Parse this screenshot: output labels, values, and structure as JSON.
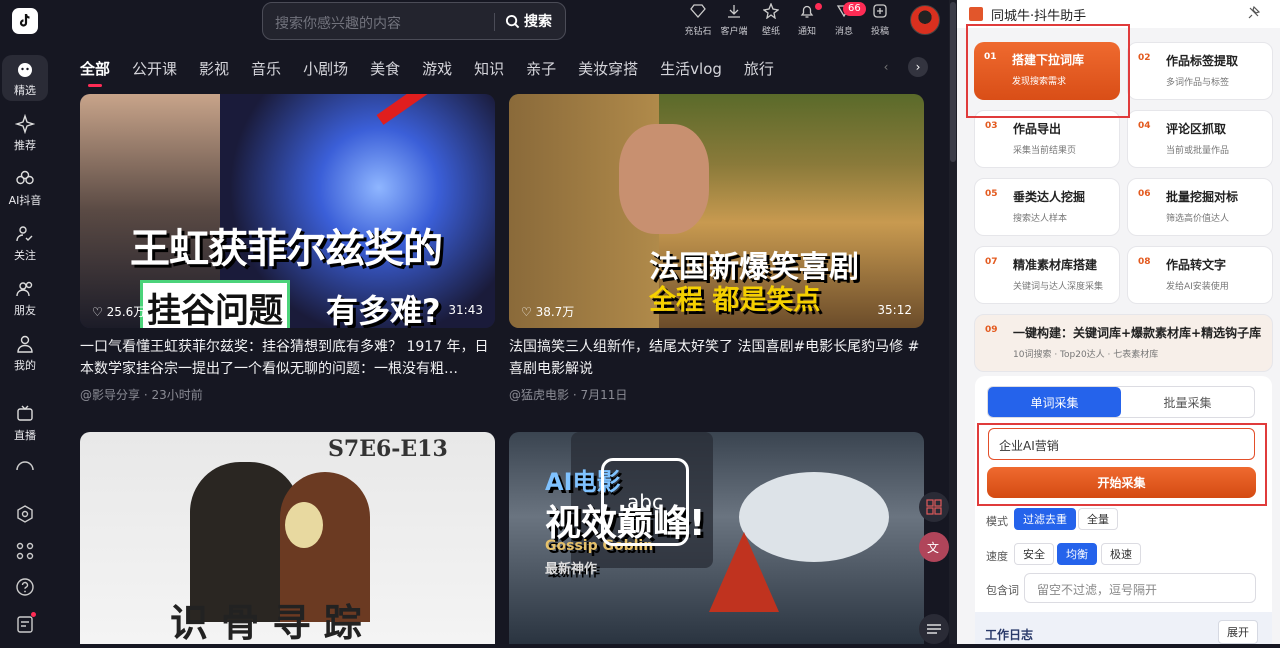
{
  "nav": {
    "items": [
      {
        "label": "精选",
        "icon": "home-icon"
      },
      {
        "label": "推荐",
        "icon": "sparkle-icon"
      },
      {
        "label": "AI抖音",
        "icon": "flower-icon"
      },
      {
        "label": "关注",
        "icon": "follow-icon"
      },
      {
        "label": "朋友",
        "icon": "friends-icon"
      },
      {
        "label": "我的",
        "icon": "person-icon"
      },
      {
        "label": "直播",
        "icon": "tv-icon"
      }
    ]
  },
  "search": {
    "placeholder": "搜索你感兴趣的内容",
    "button": "搜索"
  },
  "toolbar": [
    {
      "label": "充钻石",
      "icon": "diamond-icon"
    },
    {
      "label": "客户端",
      "icon": "download-icon"
    },
    {
      "label": "壁纸",
      "icon": "wallpaper-icon"
    },
    {
      "label": "通知",
      "icon": "bell-icon"
    },
    {
      "label": "消息",
      "icon": "message-icon",
      "badge": "66"
    },
    {
      "label": "投稿",
      "icon": "upload-icon"
    }
  ],
  "tabs": [
    "全部",
    "公开课",
    "影视",
    "音乐",
    "小剧场",
    "美食",
    "游戏",
    "知识",
    "亲子",
    "美妆穿搭",
    "生活vlog",
    "旅行"
  ],
  "videos": [
    {
      "likes": "25.6万",
      "duration": "31:43",
      "title": "一口气看懂王虹获菲尔兹奖：挂谷猜想到底有多难？ 1917 年，日本数学家挂谷宗一提出了一个看似无聊的问题：一根没有粗…",
      "author": "@影导分享",
      "time": "23小时前",
      "overlay1": "王虹获菲尔兹奖的",
      "overlay2": "挂谷问题",
      "overlay3": "有多难?"
    },
    {
      "likes": "38.7万",
      "duration": "35:12",
      "title": "法国搞笑三人组新作，结尾太好笑了 法国喜剧#电影长尾豹马修 #喜剧电影解说",
      "author": "@猛虎电影",
      "time": "7月11日",
      "overlay1": "法国新爆笑喜剧",
      "overlay2": "全程 都是笑点"
    },
    {
      "overlay1": "S7E6-E13",
      "overlay2": "识 骨 寻 踪"
    },
    {
      "overlay1": "AI电影",
      "overlay2": "视效巅峰!",
      "overlay3": "Gossip Goblin",
      "overlay4": "最新神作",
      "keyboard": "abc"
    }
  ],
  "panel": {
    "title": "同城牛·抖牛助手",
    "features": [
      {
        "num": "01",
        "title": "搭建下拉词库",
        "sub": "发现搜索需求"
      },
      {
        "num": "02",
        "title": "作品标签提取",
        "sub": "多词作品与标签"
      },
      {
        "num": "03",
        "title": "作品导出",
        "sub": "采集当前结果页"
      },
      {
        "num": "04",
        "title": "评论区抓取",
        "sub": "当前或批量作品"
      },
      {
        "num": "05",
        "title": "垂类达人挖掘",
        "sub": "搜索达人样本"
      },
      {
        "num": "06",
        "title": "批量挖掘对标",
        "sub": "筛选高价值达人"
      },
      {
        "num": "07",
        "title": "精准素材库搭建",
        "sub": "关键词与达人深度采集"
      },
      {
        "num": "08",
        "title": "作品转文字",
        "sub": "发给AI安装使用"
      },
      {
        "num": "09",
        "title": "一键构建：关键词库+爆款素材库+精选钩子库",
        "sub": "10词搜索 · Top20达人 · 七表素材库"
      }
    ],
    "seg": [
      "单词采集",
      "批量采集"
    ],
    "keyword": "企业AI营销",
    "start": "开始采集",
    "mode_label": "模式",
    "mode_opts": [
      "过滤去重",
      "全量"
    ],
    "speed_label": "速度",
    "speed_opts": [
      "安全",
      "均衡",
      "极速"
    ],
    "include_label": "包含词",
    "include_placeholder": "留空不过滤，逗号隔开",
    "log_title": "工作日志",
    "log_btn": "展开"
  }
}
